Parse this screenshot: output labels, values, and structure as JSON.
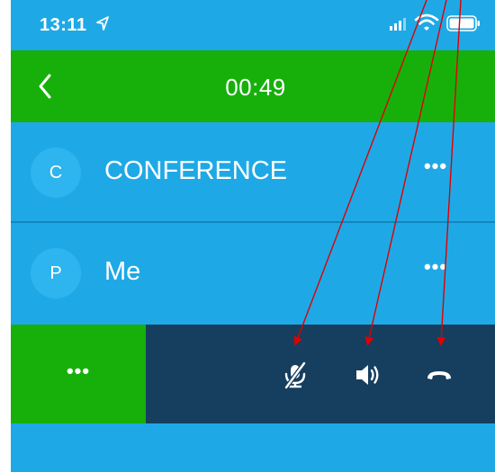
{
  "status_bar": {
    "time": "13:11",
    "icons": [
      "location-arrow-icon",
      "signal-icon",
      "wifi-icon",
      "battery-icon"
    ]
  },
  "header": {
    "timer": "00:49",
    "back_icon": "chevron-left-icon",
    "color": "#17b00b"
  },
  "participants": [
    {
      "initial": "C",
      "name": "CONFERENCE",
      "more": "•••"
    },
    {
      "initial": "P",
      "name": "Me",
      "more": "•••"
    }
  ],
  "action_bar": {
    "more": "•••",
    "controls": [
      "mute-microphone-icon",
      "speaker-icon",
      "hang-up-icon"
    ],
    "color": "#163e5f"
  },
  "annotation": {
    "arrow_color": "#e00000"
  },
  "colors": {
    "background": "#1ea9e6",
    "green": "#17b00b",
    "navy": "#163e5f"
  }
}
